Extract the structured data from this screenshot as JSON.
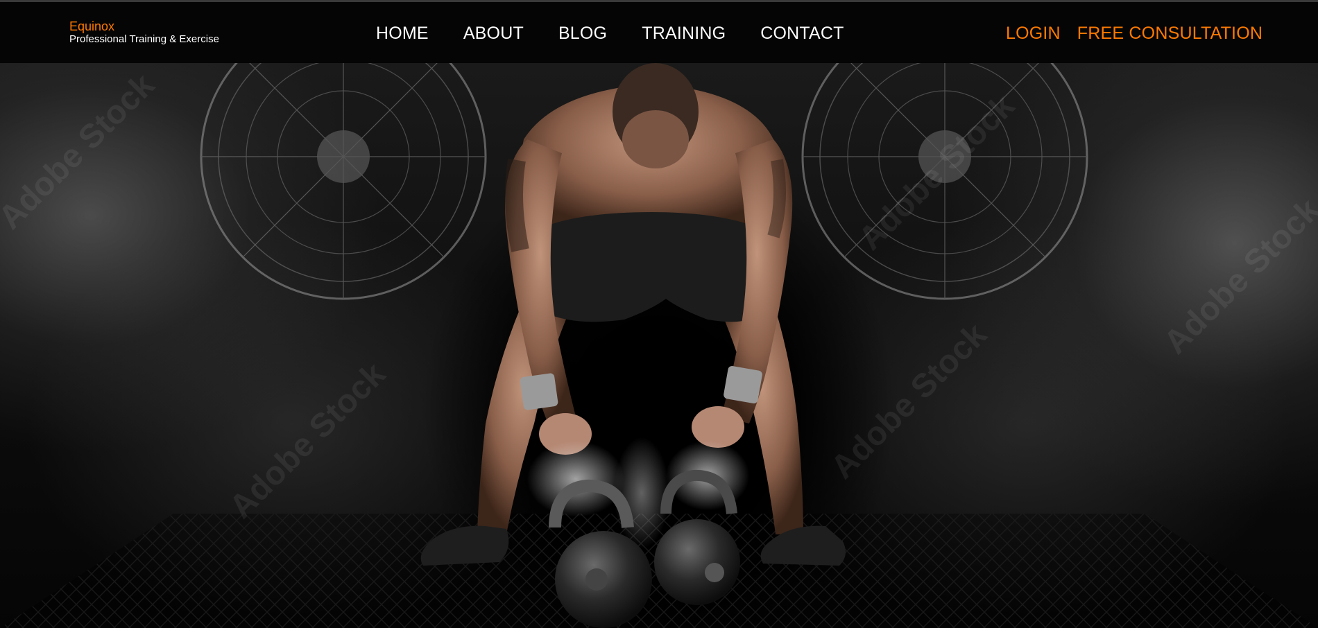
{
  "brand": {
    "name": "Equinox",
    "tagline": "Professional Training & Exercise"
  },
  "nav": {
    "items": [
      {
        "label": "HOME"
      },
      {
        "label": "ABOUT"
      },
      {
        "label": "BLOG"
      },
      {
        "label": "TRAINING"
      },
      {
        "label": "CONTACT"
      }
    ],
    "login_label": "LOGIN",
    "consultation_label": "FREE CONSULTATION"
  },
  "hero": {
    "image_subject": "athlete-with-kettlebells",
    "watermark_text": "Adobe Stock"
  },
  "colors": {
    "accent": "#ff7a00",
    "nav_text": "#ffffff",
    "background": "#000000"
  }
}
